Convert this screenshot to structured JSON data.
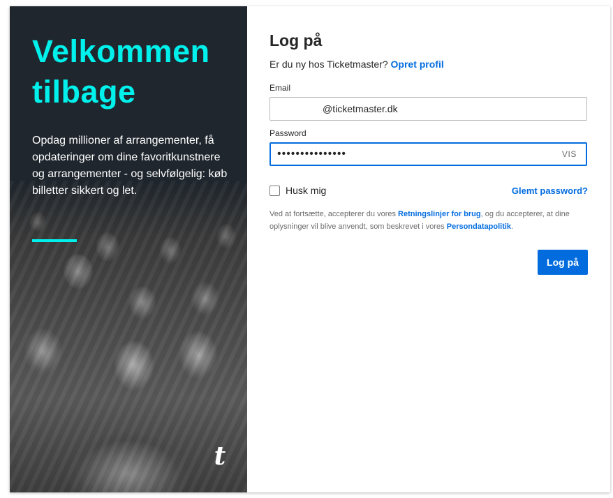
{
  "left_panel": {
    "welcome_title": "Velkommen tilbage",
    "promo_text": "Opdag millioner af arrangementer, få opdateringer om dine favoritkunstnere og arrangementer - og selvfølgelig: køb billetter sikkert og let.",
    "logo_letter": "t"
  },
  "login": {
    "title": "Log på",
    "signup_prompt": "Er du ny hos Ticketmaster?",
    "signup_link": "Opret profil",
    "email_label": "Email",
    "email_value": "@ticketmaster.dk",
    "password_label": "Password",
    "password_value": "•••••••••••••••",
    "show_password": "VIS",
    "remember_me": "Husk mig",
    "forgot_password": "Glemt password?",
    "terms_part1": "Ved at fortsætte, accepterer du vores ",
    "terms_link1": "Retningslinjer for brug",
    "terms_part2": ", og du accepterer, at dine oplysninger vil blive anvendt, som beskrevet i vores ",
    "terms_link2": "Persondatapolitik",
    "terms_part3": ".",
    "submit_label": "Log på"
  },
  "colors": {
    "accent_cyan": "#00f0ec",
    "primary_blue": "#026cdf",
    "dark_panel": "#1f262d"
  }
}
